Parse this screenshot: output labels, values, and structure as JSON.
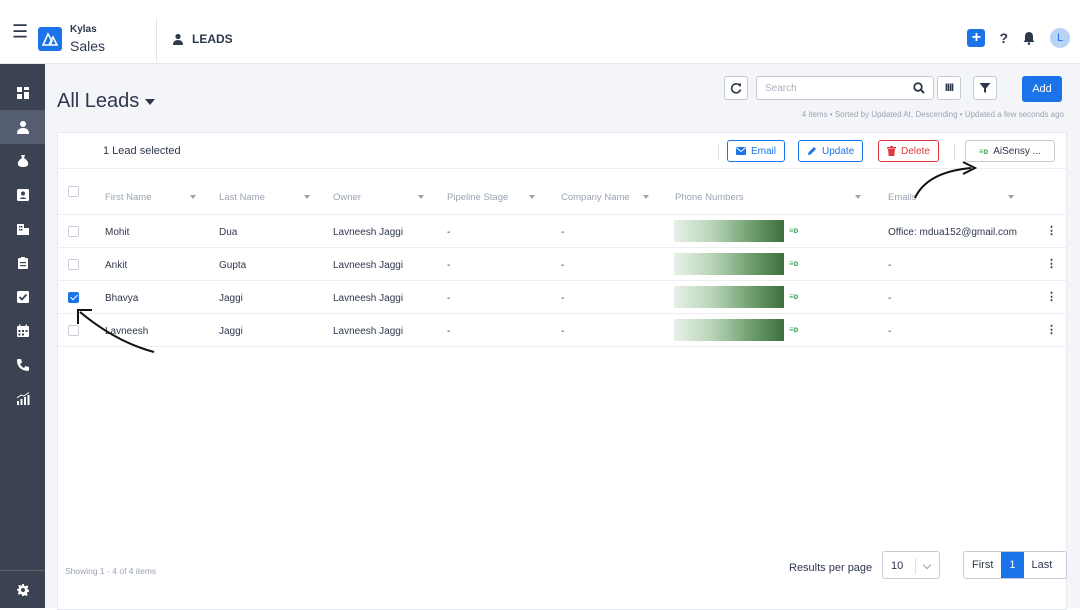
{
  "header": {
    "brand_sup": "Kylas",
    "brand_name": "Sales",
    "module": "LEADS",
    "avatar_initial": "L"
  },
  "sidebar": {
    "items": [
      {
        "icon": "dashboard-icon"
      },
      {
        "icon": "person-icon",
        "active": true
      },
      {
        "icon": "money-bag-icon"
      },
      {
        "icon": "contact-card-icon"
      },
      {
        "icon": "building-icon"
      },
      {
        "icon": "briefcase-icon"
      },
      {
        "icon": "checkbox-icon"
      },
      {
        "icon": "calendar-icon"
      },
      {
        "icon": "phone-icon"
      },
      {
        "icon": "reports-icon"
      }
    ],
    "bottom_icon": "gear-icon"
  },
  "page": {
    "title": "All Leads",
    "search_placeholder": "Search",
    "add_label": "Add",
    "meta": "4 items • Sorted by Updated At, Descending • Updated a few seconds ago"
  },
  "selection": {
    "label": "1 Lead selected",
    "email": "Email",
    "update": "Update",
    "delete": "Delete",
    "aisensy": "AiSensy ..."
  },
  "table": {
    "columns": [
      "First Name",
      "Last Name",
      "Owner",
      "Pipeline Stage",
      "Company Name",
      "Phone Numbers",
      "Emails"
    ],
    "rows": [
      {
        "first": "Mohit",
        "last": "Dua",
        "owner": "Lavneesh Jaggi",
        "stage": "-",
        "company": "-",
        "email": "Office: mdua152@gmail.com",
        "checked": false
      },
      {
        "first": "Ankit",
        "last": "Gupta",
        "owner": "Lavneesh Jaggi",
        "stage": "-",
        "company": "-",
        "email": "-",
        "checked": false
      },
      {
        "first": "Bhavya",
        "last": "Jaggi",
        "owner": "Lavneesh Jaggi",
        "stage": "-",
        "company": "-",
        "email": "-",
        "checked": true
      },
      {
        "first": "Lavneesh",
        "last": "Jaggi",
        "owner": "Lavneesh Jaggi",
        "stage": "-",
        "company": "-",
        "email": "-",
        "checked": false
      }
    ],
    "wa_glyph": "≡ᴅ"
  },
  "footer": {
    "showing": "Showing 1 - 4 of 4 items",
    "rpp_label": "Results per page",
    "rpp_value": "10",
    "first": "First",
    "page": "1",
    "last": "Last"
  },
  "colors": {
    "accent": "#1a73e8",
    "sidebar": "#3b4252",
    "danger": "#e0393e",
    "whatsapp": "#3aa457"
  }
}
